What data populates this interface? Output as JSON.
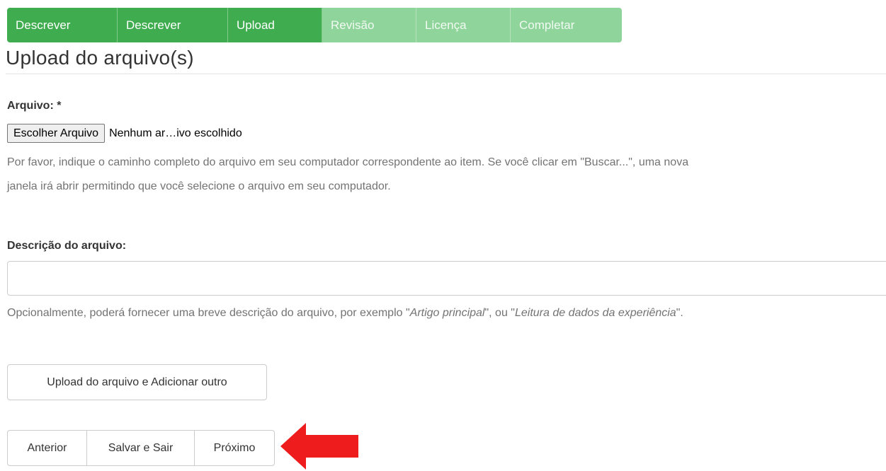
{
  "steps": [
    {
      "label": "Descrever",
      "state": "completed"
    },
    {
      "label": "Descrever",
      "state": "completed"
    },
    {
      "label": "Upload",
      "state": "current"
    },
    {
      "label": "Revisão",
      "state": "pending"
    },
    {
      "label": "Licença",
      "state": "pending"
    },
    {
      "label": "Completar",
      "state": "pending"
    }
  ],
  "page_title": "Upload do arquivo(s)",
  "file_field": {
    "label": "Arquivo: *",
    "choose_button": "Escolher Arquivo",
    "status": "Nenhum ar…ivo escolhido",
    "help_line1": "Por favor, indique o caminho completo do arquivo em seu computador correspondente ao item. Se você clicar em \"Buscar...\", uma nova",
    "help_line2": "janela irá abrir permitindo que você selecione o arquivo em seu computador."
  },
  "description_field": {
    "label": "Descrição do arquivo:",
    "value": "",
    "placeholder": "",
    "help_prefix": "Opcionalmente, poderá fornecer uma breve descrição do arquivo, por exemplo \"",
    "help_example1": "Artigo principal",
    "help_middle": "\", ou \"",
    "help_example2": "Leitura de dados da experiência",
    "help_suffix": "\"."
  },
  "buttons": {
    "upload_add": "Upload do arquivo e Adicionar outro",
    "previous": "Anterior",
    "save_exit": "Salvar e Sair",
    "next": "Próximo"
  },
  "annotation": {
    "icon": "red-arrow-left-icon",
    "color": "#ee1c1c"
  },
  "colors": {
    "step_done": "#3fad4f",
    "step_pending": "#8fd49a"
  }
}
